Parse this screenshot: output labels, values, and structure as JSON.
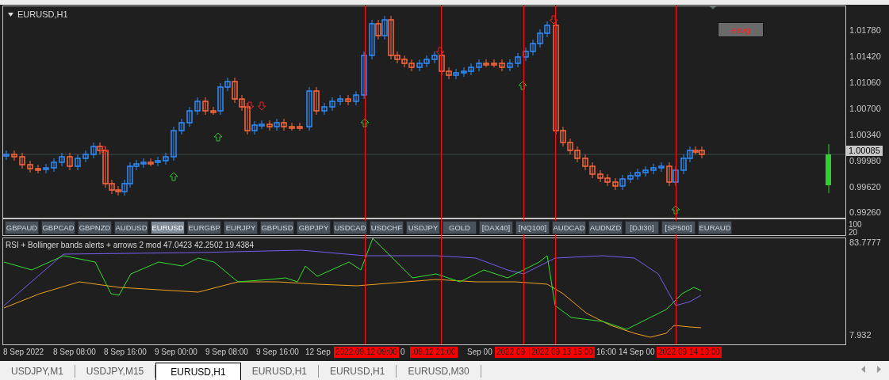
{
  "chart": {
    "title": "EURUSD,H1",
    "button": "eavg",
    "price_axis": [
      "1.01780",
      "1.01420",
      "1.01060",
      "1.00700",
      "1.00340",
      "0.99980",
      "0.99620",
      "0.99260"
    ],
    "current_price": "1.00085"
  },
  "symbol_buttons": [
    {
      "label": "GBPAUD",
      "selected": false
    },
    {
      "label": "GBPCAD",
      "selected": false
    },
    {
      "label": "GBPNZD",
      "selected": false
    },
    {
      "label": "AUDUSD",
      "selected": false
    },
    {
      "label": "EURUSD",
      "selected": true
    },
    {
      "label": "EURGBP",
      "selected": false
    },
    {
      "label": "EURJPY",
      "selected": false
    },
    {
      "label": "GBPUSD",
      "selected": false
    },
    {
      "label": "GBPJPY",
      "selected": false
    },
    {
      "label": "USDCAD",
      "selected": false
    },
    {
      "label": "USDCHF",
      "selected": false
    },
    {
      "label": "USDJPY",
      "selected": false
    },
    {
      "label": "GOLD",
      "selected": false
    },
    {
      "label": "[DAX40]",
      "selected": false
    },
    {
      "label": "[NQ100]",
      "selected": false
    },
    {
      "label": "AUDCAD",
      "selected": false
    },
    {
      "label": "AUDNZD",
      "selected": false
    },
    {
      "label": "[DJI30]",
      "selected": false
    },
    {
      "label": "[SP500]",
      "selected": false
    },
    {
      "label": "EURAUD",
      "selected": false
    }
  ],
  "button_scale": [
    "100",
    "20"
  ],
  "indicator": {
    "title": "RSI + Bollinger bands alerts + arrows 2 mod 47.0423 42.2502 19.4384",
    "scale_max": "83.7777",
    "scale_min": "7.932"
  },
  "time_axis": [
    "8 Sep 2022",
    "8 Sep 08:00",
    "8 Sep 16:00",
    "9 Sep 00:00",
    "9 Sep 08:00",
    "9 Sep 16:00",
    "12 Sep",
    "0",
    "Sep 00",
    "16:00",
    "14 Sep 00"
  ],
  "markers": [
    {
      "label": "2022.09.12 09:00"
    },
    {
      "label": ".09.12 21:00"
    },
    {
      "label": "2022.09."
    },
    {
      "label": "2022.09.13 15:00"
    },
    {
      "label": "2022.09.14 10:00"
    }
  ],
  "tabs": [
    {
      "label": "USDJPY,M1",
      "selected": false
    },
    {
      "label": "USDJPY,M15",
      "selected": false
    },
    {
      "label": "EURUSD,H1",
      "selected": true
    },
    {
      "label": "EURUSD,H1",
      "selected": false
    },
    {
      "label": "EURUSD,H1",
      "selected": false
    },
    {
      "label": "EURUSD,M30",
      "selected": false
    }
  ]
}
